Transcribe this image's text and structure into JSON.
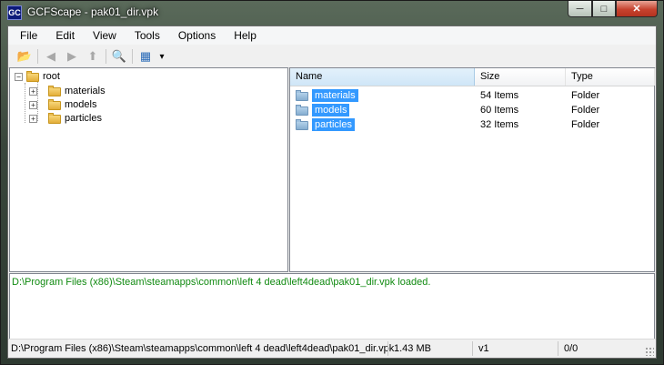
{
  "window": {
    "title": "GCFScape - pak01_dir.vpk",
    "app_icon_text": "GC",
    "controls": {
      "minimize": "─",
      "maximize": "□",
      "close": "✕"
    }
  },
  "menu": [
    "File",
    "Edit",
    "View",
    "Tools",
    "Options",
    "Help"
  ],
  "toolbar": {
    "icons": [
      "open-folder-icon",
      "back-arrow-icon",
      "forward-arrow-icon",
      "up-folder-icon",
      "search-icon",
      "view-mode-icon",
      "dropdown-arrow-icon"
    ],
    "glyphs": {
      "open": "📂",
      "back": "◀",
      "forward": "▶",
      "up": "⬆",
      "search": "🔍",
      "view": "▦",
      "dropdown": "▾"
    }
  },
  "tree": {
    "root": "root",
    "children": [
      "materials",
      "models",
      "particles"
    ],
    "expander_collapsed": "+",
    "expander_expanded": "−"
  },
  "list": {
    "columns": [
      "Name",
      "Size",
      "Type"
    ],
    "rows": [
      {
        "name": "materials",
        "size": "54 Items",
        "type": "Folder"
      },
      {
        "name": "models",
        "size": "60 Items",
        "type": "Folder"
      },
      {
        "name": "particles",
        "size": "32 Items",
        "type": "Folder"
      }
    ]
  },
  "log": {
    "message": "D:\\Program Files (x86)\\Steam\\steamapps\\common\\left 4 dead\\left4dead\\pak01_dir.vpk loaded.",
    "color": "#108a10"
  },
  "status": {
    "path": "D:\\Program Files (x86)\\Steam\\steamapps\\common\\left 4 dead\\left4dead\\pak01_dir.vpk",
    "size": "1.43 MB",
    "version": "v1",
    "count": "0/0"
  },
  "colors": {
    "selection": "#3399ff",
    "log_text": "#108a10"
  }
}
